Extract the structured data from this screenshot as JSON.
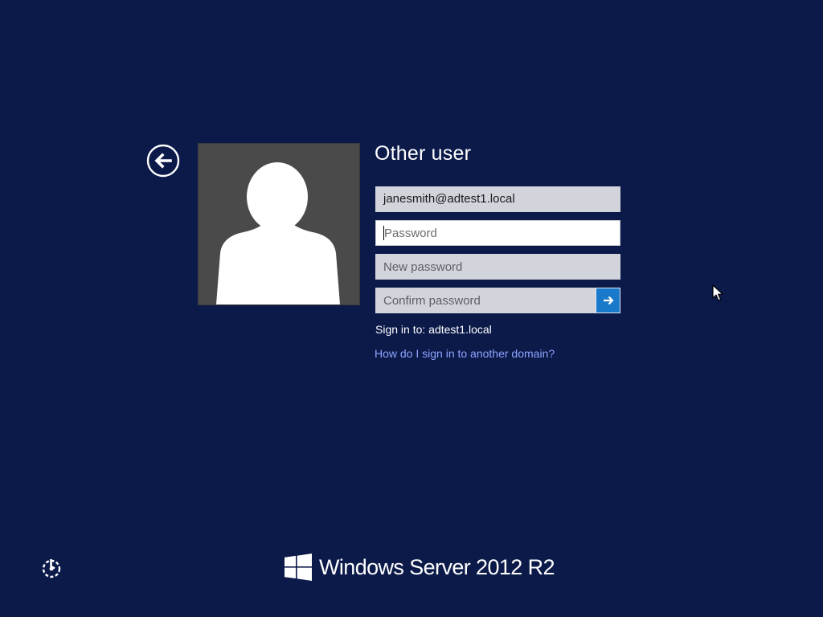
{
  "login": {
    "title": "Other user",
    "username_value": "janesmith@adtest1.local",
    "password_placeholder": "Password",
    "new_password_placeholder": "New password",
    "confirm_password_placeholder": "Confirm password",
    "sign_in_to": "Sign in to: adtest1.local",
    "help_link": "How do I sign in to another domain?"
  },
  "icons": {
    "back": "arrow-left-circle-icon",
    "submit": "arrow-right-icon",
    "ease_of_access": "ease-of-access-icon",
    "brand_logo": "windows-logo-icon",
    "avatar": "user-silhouette-icon",
    "mouse": "mouse-pointer-icon"
  },
  "brand": {
    "text": "Windows Server 2012 R2"
  },
  "colors": {
    "background": "#0c1a4a",
    "accent": "#1979ca",
    "link": "#8fa4ff",
    "field_bg": "#d2d4dc",
    "avatar_bg": "#4a4a4a"
  }
}
